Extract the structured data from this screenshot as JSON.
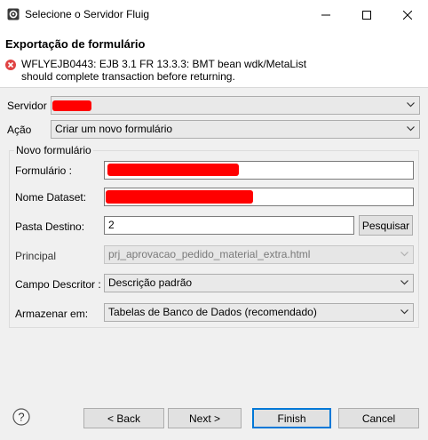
{
  "window": {
    "title": "Selecione o Servidor Fluig",
    "icons": [
      "app-icon",
      "minimize-icon",
      "maximize-icon",
      "close-icon"
    ]
  },
  "header": {
    "title": "Exportação de formulário",
    "error_icon": "error-icon",
    "error_message": "WFLYEJB0443: EJB 3.1 FR 13.3.3: BMT bean wdk/MetaList\nshould complete transaction before returning."
  },
  "form": {
    "servidor": {
      "label": "Servidor",
      "value": ""
    },
    "acao": {
      "label": "Ação",
      "value": "Criar um novo formulário"
    },
    "group_title": "Novo formulário",
    "formulario": {
      "label": "Formulário :",
      "value": ""
    },
    "nome_dataset": {
      "label": "Nome Dataset:",
      "value": ""
    },
    "pasta_destino": {
      "label": "Pasta Destino:",
      "value": "2",
      "button": "Pesquisar"
    },
    "principal": {
      "label": "Principal",
      "value": "prj_aprovacao_pedido_material_extra.html"
    },
    "campo_descritor": {
      "label": "Campo Descritor :",
      "value": "Descrição padrão"
    },
    "armazenar_em": {
      "label": "Armazenar em:",
      "value": "Tabelas de Banco de Dados (recomendado)"
    }
  },
  "footer": {
    "help_icon": "help-icon",
    "back": "< Back",
    "next": "Next >",
    "finish": "Finish",
    "cancel": "Cancel"
  },
  "colors": {
    "redaction": "#ff0000",
    "error": "#e04343",
    "focus_border": "#0078d7"
  }
}
